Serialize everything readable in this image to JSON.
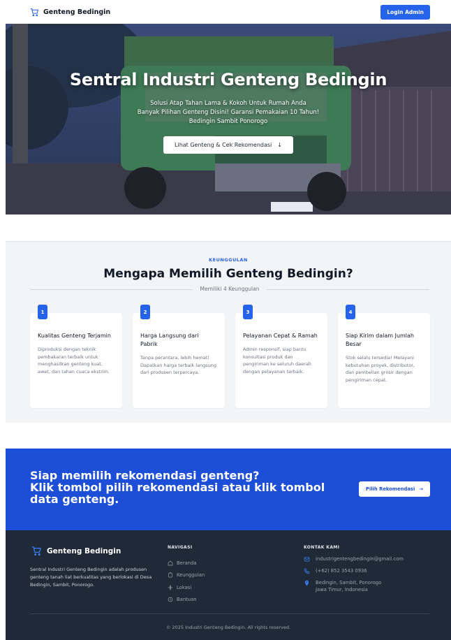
{
  "nav": {
    "brand": "Genteng Bedingin",
    "login_label": "Login Admin"
  },
  "hero": {
    "title": "Sentral Industri Genteng Bedingin",
    "subtitle_lines": [
      "Solusi Atap Tahan Lama & Kokoh Untuk Rumah Anda",
      "Banyak Pilihan Genteng Disini! Garansi Pemakaian 10 Tahun!",
      "Bedingin Sambit Ponorogo"
    ],
    "cta_label": "Lihat Genteng & Cek Rekomendasi",
    "cta_arrow": "↓"
  },
  "features": {
    "kicker": "KEUNGGULAN",
    "title": "Mengapa Memilih Genteng Bedingin?",
    "divider_text": "Memiliki 4 Keunggulan",
    "cards": [
      {
        "num": "1",
        "title": "Kualitas Genteng Terjamin",
        "desc": "Diproduksi dengan teknik pembakaran terbaik untuk menghasilkan genteng kuat, awet, dan tahan cuaca ekstrim."
      },
      {
        "num": "2",
        "title": "Harga Langsung dari Pabrik",
        "desc": "Tanpa perantara, lebih hemat! Dapatkan harga terbaik langsung dari produsen terpercaya."
      },
      {
        "num": "3",
        "title": "Pelayanan Cepat & Ramah",
        "desc": "Admin responsif, siap bantu konsultasi produk dan pengiriman ke seluruh daerah dengan pelayanan terbaik."
      },
      {
        "num": "4",
        "title": "Siap Kirim dalam Jumlah Besar",
        "desc": "Stok selalu tersedia! Melayani kebutuhan proyek, distributor, dan pembelian grosir dengan pengiriman cepat."
      }
    ]
  },
  "cta": {
    "line1": "Siap memilih rekomendasi genteng?",
    "line2": "Klik tombol pilih rekomendasi atau klik tombol data genteng.",
    "button_label": "Pilih Rekomendasi",
    "button_arrow": "→"
  },
  "footer": {
    "brand": "Genteng Bedingin",
    "description": "Sentral Industri Genteng Bedingin adalah produsen genteng tanah liat berkualitas yang berlokasi di Desa Bedingin, Sambit, Ponorogo.",
    "nav_title": "NAVIGASI",
    "nav_items": [
      {
        "label": "Beranda",
        "icon": "home-icon"
      },
      {
        "label": "Keunggulan",
        "icon": "clipboard-icon"
      },
      {
        "label": "Lokasi",
        "icon": "map-pin-icon"
      },
      {
        "label": "Bantuan",
        "icon": "help-icon"
      }
    ],
    "contact_title": "KONTAK KAMI",
    "email": "industrigentengbedingin@gmail.com",
    "phone": "(+62) 852 3543 0936",
    "address_line1": "Bedingin, Sambit, Ponorogo",
    "address_line2": "Jawa Timur, Indonesia",
    "copyright": "© 2025 Industri Genteng Bedingin. All rights reserved."
  },
  "colors": {
    "primary": "#2563eb",
    "cta_bg": "#1d4ed8",
    "footer_bg": "#1f2937",
    "section_bg": "#f3f4f6"
  }
}
